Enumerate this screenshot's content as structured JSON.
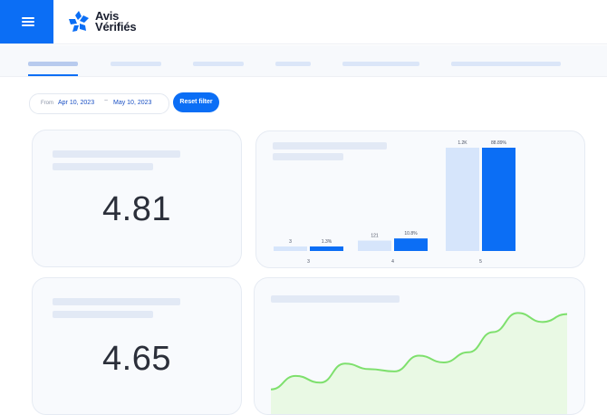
{
  "header": {
    "brand_line1": "Avis",
    "brand_line2": "Vérifiés"
  },
  "filter": {
    "from_label": "From",
    "from_date": "Apr 10, 2023",
    "separator": "~",
    "to_date": "May 10, 2023",
    "reset_label": "Reset filter"
  },
  "cards": {
    "rating_1": "4.81",
    "rating_2": "4.65"
  },
  "chart_data": [
    {
      "type": "bar",
      "categories": [
        "3",
        "4",
        "5"
      ],
      "series": [
        {
          "values": [
            3,
            121,
            1200
          ],
          "labels": [
            "3",
            "121",
            "1.2K"
          ],
          "color": "#d6e5fb"
        },
        {
          "values": [
            1.3,
            10.8,
            88.89
          ],
          "labels": [
            "1.3%",
            "10.8%",
            "88.89%"
          ],
          "color": "#0b6ef5"
        }
      ]
    },
    {
      "type": "area",
      "values": [
        0.22,
        0.34,
        0.28,
        0.45,
        0.4,
        0.38,
        0.52,
        0.46,
        0.55,
        0.73,
        0.9,
        0.82,
        0.89
      ],
      "color": "#7ee06d",
      "fill": "#e9f9e4"
    }
  ],
  "colors": {
    "accent": "#0b6ef5",
    "bar_light": "#d6e5fb",
    "area_line": "#7ee06d",
    "area_fill": "#e9f9e4"
  }
}
